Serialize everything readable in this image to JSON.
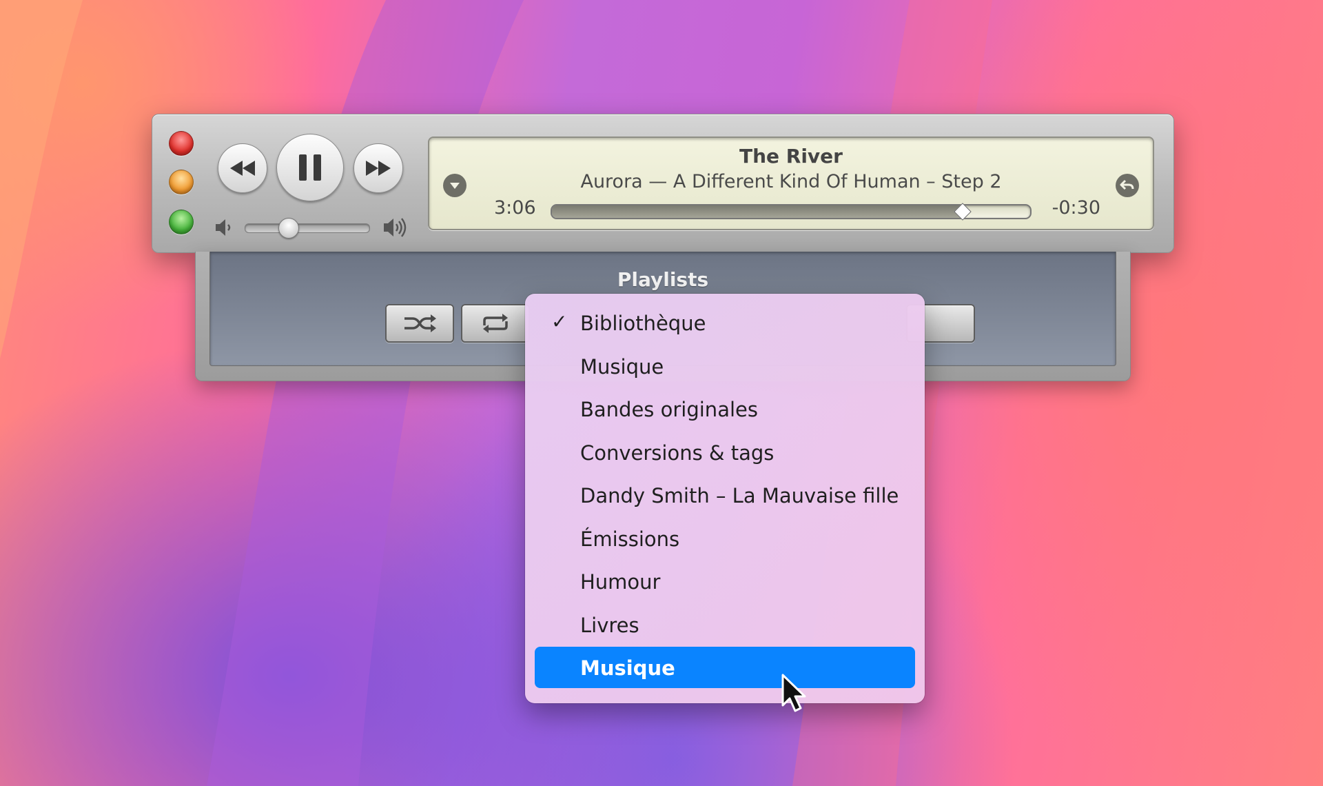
{
  "player": {
    "track_title": "The River",
    "track_subtitle": "Aurora — A Different Kind Of Human – Step 2",
    "elapsed": "3:06",
    "remaining": "-0:30",
    "progress": 0.86,
    "volume": 0.35,
    "icons": {
      "close": "close-traffic-light",
      "minimize": "minimize-traffic-light",
      "zoom": "zoom-traffic-light",
      "rewind": "rewind-icon",
      "pause": "pause-icon",
      "forward": "fast-forward-icon",
      "volume_low": "speaker-low-icon",
      "volume_high": "speaker-high-icon",
      "display_menu": "chevron-down-icon",
      "back": "return-icon"
    }
  },
  "drawer": {
    "title": "Playlists",
    "icons": {
      "shuffle": "shuffle-icon",
      "repeat": "repeat-icon"
    }
  },
  "menu": {
    "items": [
      {
        "label": "Bibliothèque",
        "checked": true,
        "highlighted": false
      },
      {
        "label": "Musique",
        "checked": false,
        "highlighted": false
      },
      {
        "label": "Bandes originales",
        "checked": false,
        "highlighted": false
      },
      {
        "label": "Conversions & tags",
        "checked": false,
        "highlighted": false
      },
      {
        "label": "Dandy Smith – La Mauvaise fille",
        "checked": false,
        "highlighted": false
      },
      {
        "label": "Émissions",
        "checked": false,
        "highlighted": false
      },
      {
        "label": "Humour",
        "checked": false,
        "highlighted": false
      },
      {
        "label": "Livres",
        "checked": false,
        "highlighted": false
      },
      {
        "label": "Musique",
        "checked": false,
        "highlighted": true
      }
    ],
    "check_glyph": "✓",
    "highlight_color": "#0a84ff"
  }
}
